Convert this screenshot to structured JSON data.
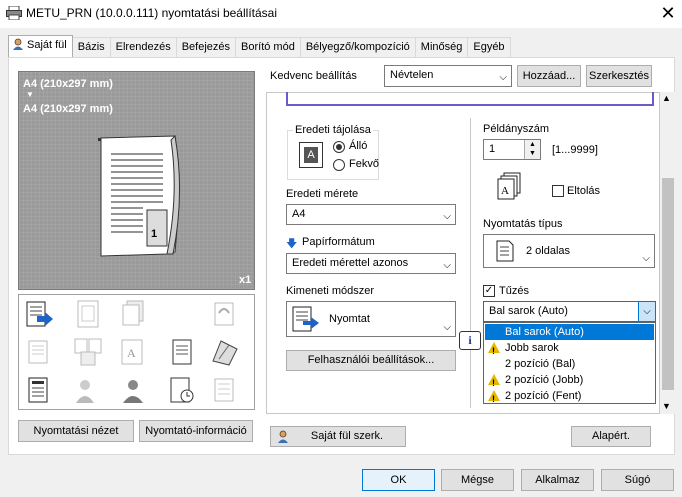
{
  "window": {
    "title": "METU_PRN (10.0.0.111) nyomtatási beállításai",
    "close": "✕"
  },
  "tabs": [
    "Saját fül",
    "Bázis",
    "Elrendezés",
    "Befejezés",
    "Borító mód",
    "Bélyegző/kompozíció",
    "Minőség",
    "Egyéb"
  ],
  "preview": {
    "line1": "A4 (210x297 mm)",
    "arrow": "▼",
    "line2": "A4 (210x297 mm)",
    "page_num": "1",
    "copies_badge": "x1"
  },
  "left_buttons": {
    "print_view": "Nyomtatási nézet",
    "printer_info": "Nyomtató-információ"
  },
  "favorite": {
    "label": "Kedvenc beállítás",
    "value": "Névtelen",
    "add": "Hozzáad...",
    "edit": "Szerkesztés"
  },
  "orientation": {
    "group": "Eredeti tájolása",
    "portrait": "Álló",
    "landscape": "Fekvő",
    "icon_letter": "A"
  },
  "original_size": {
    "label": "Eredeti mérete",
    "value": "A4"
  },
  "paper_size": {
    "label": "Papírformátum",
    "value": "Eredeti mérettel azonos"
  },
  "output": {
    "label": "Kimeneti módszer",
    "value": "Nyomtat"
  },
  "user_settings": "Felhasználói beállítások...",
  "copies": {
    "label": "Példányszám",
    "value": "1",
    "range": "[1...9999]",
    "offset": "Eltolás"
  },
  "print_type": {
    "label": "Nyomtatás típus",
    "value": "2 oldalas"
  },
  "staple": {
    "label": "Tűzés",
    "value": "Bal sarok (Auto)",
    "options": [
      {
        "text": "Bal sarok (Auto)",
        "warning": false,
        "selected": true
      },
      {
        "text": "Jobb sarok",
        "warning": true,
        "selected": false
      },
      {
        "text": "2 pozíció (Bal)",
        "warning": false,
        "selected": false
      },
      {
        "text": "2 pozíció (Jobb)",
        "warning": true,
        "selected": false
      },
      {
        "text": "2 pozíció (Fent)",
        "warning": true,
        "selected": false
      }
    ]
  },
  "info_icon": "i",
  "bottom": {
    "own_tab_edit": "Saját fül szerk.",
    "defaults": "Alapért."
  },
  "dialog": {
    "ok": "OK",
    "cancel": "Mégse",
    "apply": "Alkalmaz",
    "help": "Súgó"
  },
  "colors": {
    "accent": "#0078d7",
    "warning": "#e6b800",
    "preview_bg": "#9a9a9a"
  }
}
